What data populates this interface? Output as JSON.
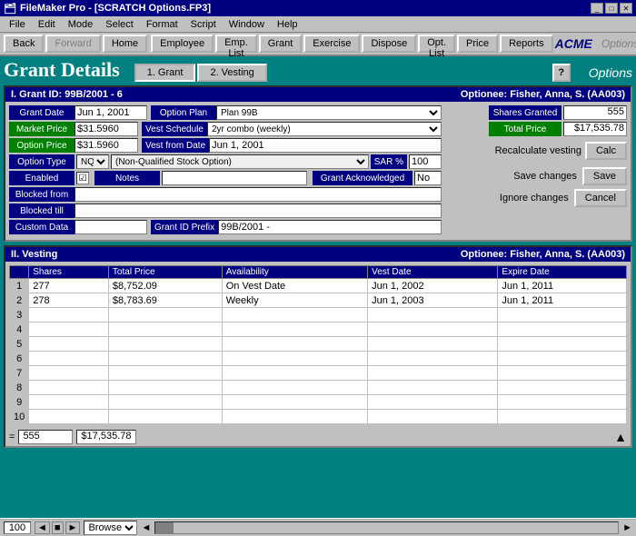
{
  "window": {
    "title": "FileMaker Pro - [SCRATCH Options.FP3]",
    "icon": "fm-icon"
  },
  "menubar": {
    "items": [
      "File",
      "Edit",
      "Mode",
      "Select",
      "Format",
      "Script",
      "Window",
      "Help"
    ]
  },
  "toolbar": {
    "buttons": [
      "Back",
      "Forward",
      "Home",
      "Employee",
      "Emp. List",
      "Grant",
      "Exercise",
      "Dispose",
      "Opt. List",
      "Price",
      "Reports"
    ],
    "forward_disabled": true,
    "brand": "ACME",
    "section_label": "Options"
  },
  "page": {
    "title": "Grant Details",
    "tabs": [
      {
        "label": "1. Grant",
        "active": true
      },
      {
        "label": "2. Vesting",
        "active": false
      }
    ],
    "help_label": "?"
  },
  "section1": {
    "header_left": "I. Grant ID: 99B/2001 - 6",
    "header_right": "Optionee: Fisher, Anna, S. (AA003)",
    "fields": {
      "grant_date_label": "Grant Date",
      "grant_date_value": "Jun 1, 2001",
      "option_plan_label": "Option Plan",
      "option_plan_value": "Plan 99B",
      "market_price_label": "Market Price",
      "market_price_value": "$31.5960",
      "vest_schedule_label": "Vest Schedule",
      "vest_schedule_value": "2yr combo (weekly)",
      "option_price_label": "Option Price",
      "option_price_value": "$31.5960",
      "vest_from_date_label": "Vest from Date",
      "vest_from_date_value": "Jun 1, 2001",
      "option_type_label": "Option Type",
      "option_type_value": "NQ",
      "option_type_desc": "(Non-Qualified Stock Option)",
      "sar_label": "SAR %",
      "sar_value": "100",
      "enabled_label": "Enabled",
      "enabled_checked": true,
      "notes_label": "Notes",
      "notes_value": "",
      "grant_acknowledged_label": "Grant Acknowledged",
      "grant_acknowledged_value": "No",
      "blocked_from_label": "Blocked from",
      "blocked_from_value": "",
      "blocked_till_label": "Blocked till",
      "blocked_till_value": "",
      "custom_data_label": "Custom Data",
      "custom_data_value": "",
      "grant_id_prefix_label": "Grant ID Prefix",
      "grant_id_prefix_value": "99B/2001 -"
    },
    "right": {
      "shares_granted_label": "Shares Granted",
      "shares_granted_value": "555",
      "total_price_label": "Total Price",
      "total_price_value": "$17,535.78",
      "recalculate_label": "Recalculate vesting",
      "calc_btn": "Calc",
      "save_label": "Save changes",
      "save_btn": "Save",
      "cancel_label": "Ignore changes",
      "cancel_btn": "Cancel"
    }
  },
  "section2": {
    "header_left": "II. Vesting",
    "header_right": "Optionee: Fisher, Anna, S. (AA003)",
    "table": {
      "headers": [
        "Shares",
        "Total Price",
        "Availability",
        "Vest Date",
        "Expire Date"
      ],
      "rows": [
        {
          "num": "1",
          "shares": "277",
          "total_price": "$8,752.09",
          "availability": "On Vest Date",
          "vest_date": "Jun 1, 2002",
          "expire_date": "Jun 1, 2011"
        },
        {
          "num": "2",
          "shares": "278",
          "total_price": "$8,783.69",
          "availability": "Weekly",
          "vest_date": "Jun 1, 2003",
          "expire_date": "Jun 1, 2011"
        },
        {
          "num": "3",
          "shares": "",
          "total_price": "",
          "availability": "",
          "vest_date": "",
          "expire_date": ""
        },
        {
          "num": "4",
          "shares": "",
          "total_price": "",
          "availability": "",
          "vest_date": "",
          "expire_date": ""
        },
        {
          "num": "5",
          "shares": "",
          "total_price": "",
          "availability": "",
          "vest_date": "",
          "expire_date": ""
        },
        {
          "num": "6",
          "shares": "",
          "total_price": "",
          "availability": "",
          "vest_date": "",
          "expire_date": ""
        },
        {
          "num": "7",
          "shares": "",
          "total_price": "",
          "availability": "",
          "vest_date": "",
          "expire_date": ""
        },
        {
          "num": "8",
          "shares": "",
          "total_price": "",
          "availability": "",
          "vest_date": "",
          "expire_date": ""
        },
        {
          "num": "9",
          "shares": "",
          "total_price": "",
          "availability": "",
          "vest_date": "",
          "expire_date": ""
        },
        {
          "num": "10",
          "shares": "",
          "total_price": "",
          "availability": "",
          "vest_date": "",
          "expire_date": ""
        }
      ],
      "footer_eq": "=",
      "footer_shares": "555",
      "footer_total": "$17,535.78"
    }
  },
  "statusbar": {
    "zoom": "100",
    "mode": "Browse"
  }
}
